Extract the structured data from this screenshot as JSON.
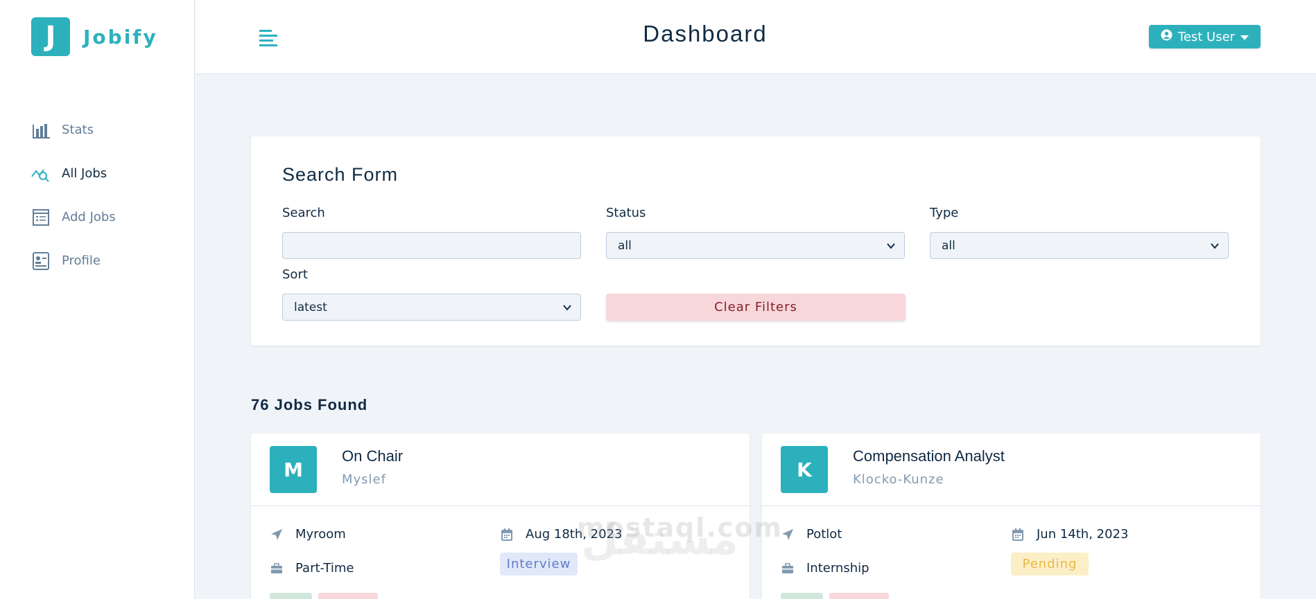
{
  "app": {
    "logo_letter": "J",
    "name": "Jobify"
  },
  "sidebar": {
    "items": [
      {
        "label": "Stats",
        "icon": "bar-chart-icon"
      },
      {
        "label": "All Jobs",
        "icon": "chart-search-icon",
        "active": true
      },
      {
        "label": "Add Jobs",
        "icon": "form-icon"
      },
      {
        "label": "Profile",
        "icon": "id-card-icon"
      }
    ]
  },
  "header": {
    "title": "Dashboard",
    "user_label": "Test User"
  },
  "search_form": {
    "title": "Search Form",
    "search": {
      "label": "Search",
      "value": ""
    },
    "status": {
      "label": "Status",
      "value": "all"
    },
    "type": {
      "label": "Type",
      "value": "all"
    },
    "sort": {
      "label": "Sort",
      "value": "latest"
    },
    "clear_label": "Clear Filters"
  },
  "results": {
    "count_label": "76 Jobs Found"
  },
  "jobs": [
    {
      "avatar_letter": "M",
      "position": "On Chair",
      "company": "Myslef",
      "location": "Myroom",
      "date": "Aug 18th, 2023",
      "job_type": "Part-Time",
      "status": "Interview",
      "status_bg": "#e0e8f9",
      "status_color": "#647acb"
    },
    {
      "avatar_letter": "K",
      "position": "Compensation Analyst",
      "company": "Klocko-Kunze",
      "location": "Potlot",
      "date": "Jun 14th, 2023",
      "job_type": "Internship",
      "status": "Pending",
      "status_bg": "#fcefc7",
      "status_color": "#e9b949"
    }
  ],
  "watermark": {
    "text": "mostaql.com",
    "arabic": "مستقل"
  },
  "colors": {
    "primary": "#2cb1bc",
    "background": "#f0f4f8",
    "danger_light": "#f8d7da"
  }
}
